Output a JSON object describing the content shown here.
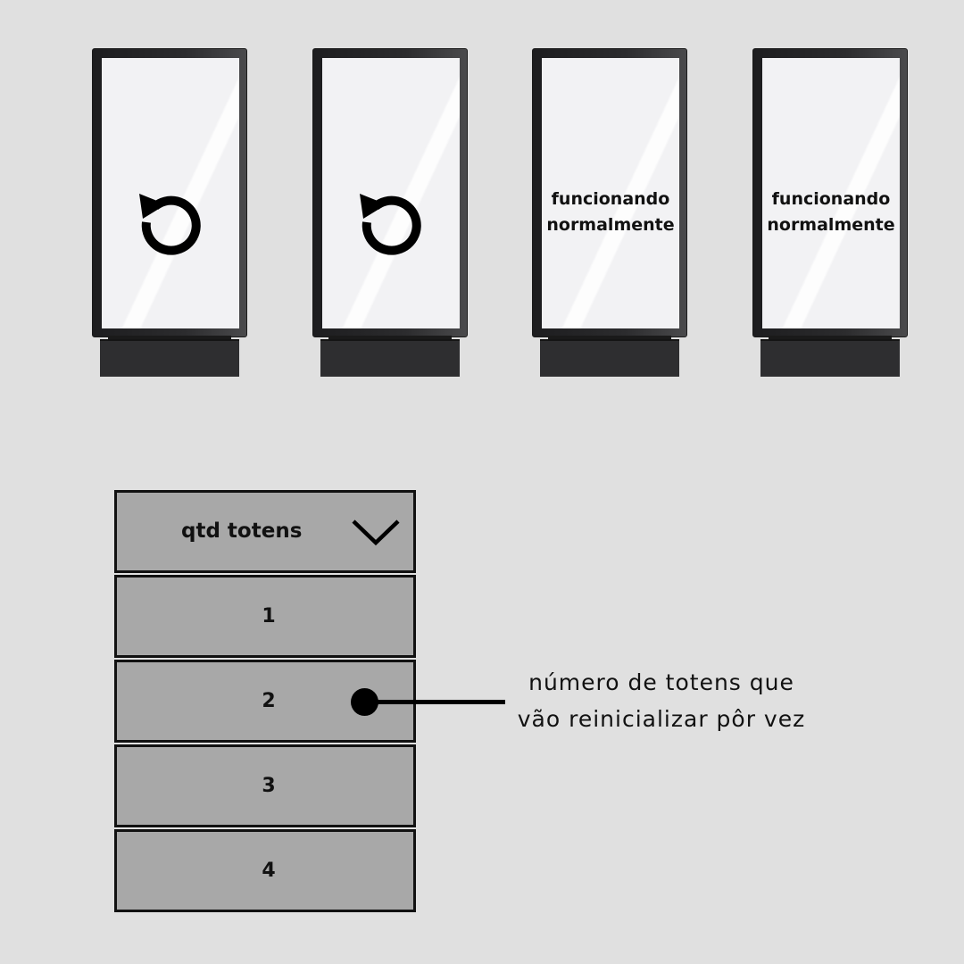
{
  "totems": [
    {
      "state": "reiniciando",
      "icon": "reload-icon"
    },
    {
      "state": "reiniciando",
      "icon": "reload-icon"
    },
    {
      "state": "funcionando",
      "status_line1": "funcionando",
      "status_line2": "normalmente"
    },
    {
      "state": "funcionando",
      "status_line1": "funcionando",
      "status_line2": "normalmente"
    }
  ],
  "dropdown": {
    "title": "qtd totens",
    "icon": "chevron-down-icon",
    "options": [
      "1",
      "2",
      "3",
      "4"
    ]
  },
  "callout": {
    "line1": "número de totens que",
    "line2": "vão reinicializar pôr vez"
  },
  "colors": {
    "background": "#e0e0e0",
    "dropdown_fill": "#a8a8a8",
    "screen": "#f2f2f4",
    "frame": "#2c2c2e"
  }
}
